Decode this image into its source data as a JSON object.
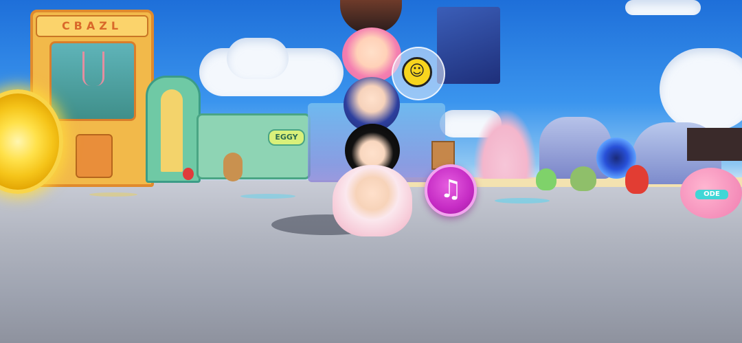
{
  "scene": {
    "sign_left": "CBAZL",
    "sign_shop": "EGGY",
    "right_character_badge": "ODE"
  },
  "hud": {
    "emote_button_icon": "music-note-icon",
    "emote_bubble_icon": "grinning-face-icon"
  },
  "colors": {
    "sky_top": "#1e6fd9",
    "ground": "#9ea3b0",
    "emote_button": "#d22ad0",
    "portal_gold": "#f5c419"
  }
}
